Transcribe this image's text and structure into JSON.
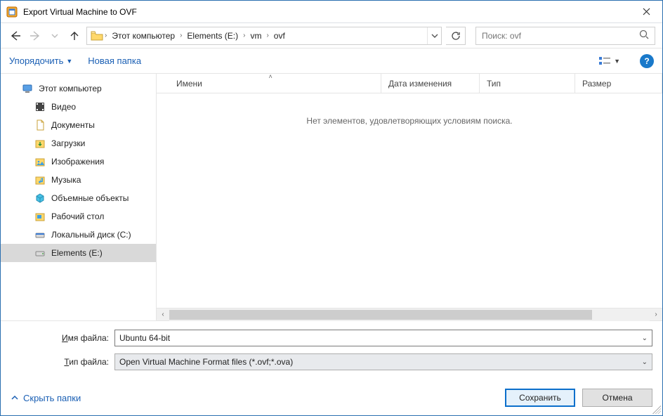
{
  "window": {
    "title": "Export Virtual Machine to OVF"
  },
  "breadcrumb": {
    "items": [
      "Этот компьютер",
      "Elements (E:)",
      "vm",
      "ovf"
    ]
  },
  "search": {
    "placeholder": "Поиск: ovf"
  },
  "toolbar": {
    "organize": "Упорядочить",
    "new_folder": "Новая папка"
  },
  "sidebar": {
    "root": "Этот компьютер",
    "items": [
      {
        "label": "Видео",
        "icon": "video"
      },
      {
        "label": "Документы",
        "icon": "document"
      },
      {
        "label": "Загрузки",
        "icon": "download"
      },
      {
        "label": "Изображения",
        "icon": "images"
      },
      {
        "label": "Музыка",
        "icon": "music"
      },
      {
        "label": "Объемные объекты",
        "icon": "3d"
      },
      {
        "label": "Рабочий стол",
        "icon": "desktop"
      },
      {
        "label": "Локальный диск (C:)",
        "icon": "disk"
      },
      {
        "label": "Elements (E:)",
        "icon": "drive",
        "selected": true
      }
    ]
  },
  "columns": {
    "name": "Имени",
    "date": "Дата изменения",
    "type": "Тип",
    "size": "Размер"
  },
  "list": {
    "empty": "Нет элементов, удовлетворяющих условиям поиска."
  },
  "form": {
    "filename_label_pre": "И",
    "filename_label_post": "мя файла:",
    "filename_value": "Ubuntu 64-bit",
    "filetype_label_pre": "Т",
    "filetype_label_post": "ип файла:",
    "filetype_value": "Open Virtual Machine Format files (*.ovf;*.ova)"
  },
  "footer": {
    "hide_folders": "Скрыть папки",
    "save": "Сохранить",
    "cancel": "Отмена"
  }
}
